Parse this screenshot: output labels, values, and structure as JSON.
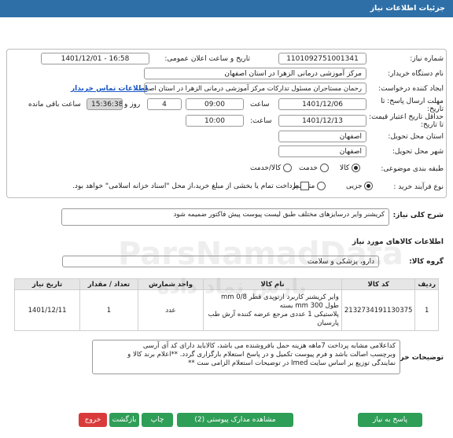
{
  "window": {
    "title": "جزئیات اطلاعات نیاز"
  },
  "fields": {
    "need_number_label": "شماره نیاز:",
    "need_number": "1101092751001341",
    "announce_datetime_label": "تاریخ و ساعت اعلان عمومی:",
    "announce_datetime": "1401/12/01 - 16:58",
    "buyer_org_label": "نام دستگاه خریدار:",
    "buyer_org": "مرکز آموزشی درمانی الزهرا در استان اصفهان",
    "requester_label": "ایجاد کننده درخواست:",
    "requester": "رحمان مستاجران مسئول تدارکات مرکز آموزشی درمانی الزهرا در استان اصفهان",
    "buyer_contact_link": "اطلاعات تماس خریدار",
    "reply_deadline_label": "مهلت ارسال پاسخ: تا تاریخ:",
    "reply_deadline_date": "1401/12/06",
    "time_label": "ساعت",
    "reply_deadline_time": "09:00",
    "days_value": "4",
    "days_label": "روز و",
    "remaining_time": "15:36:38",
    "remaining_label": "ساعت باقی مانده",
    "price_validity_label": "حداقل تاریخ اعتبار قیمت: تا تاریخ:",
    "price_validity_date": "1401/12/13",
    "price_validity_time_label": "ساعت:",
    "price_validity_time": "10:00",
    "delivery_province_label": "استان محل تحویل:",
    "delivery_province": "اصفهان",
    "delivery_city_label": "شهر محل تحویل:",
    "delivery_city": "اصفهان",
    "category_label": "طبقه بندی موضوعی:",
    "category_options": [
      "کالا",
      "خدمت",
      "کالا/خدمت"
    ],
    "process_label": "نوع فرآیند خرید :",
    "process_options": [
      "جزیی",
      "متوسط"
    ],
    "payment_note": "پرداخت تمام یا بخشی از مبلغ خرید،از محل \"اسناد خزانه اسلامی\" خواهد بود."
  },
  "general_description": {
    "label": "شرح کلی نیاز:",
    "value": "کریشنر وایر درسایزهای مختلف طبق لیست پیوست پیش فاکتور ضمیمه شود"
  },
  "goods_section": {
    "title": "اطلاعات کالاهای مورد نیاز",
    "group_label": "گروه کالا:",
    "group_value": "دارو، پزشکی و سلامت"
  },
  "table": {
    "headers": [
      "ردیف",
      "کد کالا",
      "نام کالا",
      "واحد شمارش",
      "تعداد / مقدار",
      "تاریخ نیاز"
    ],
    "rows": [
      {
        "row": "1",
        "code": "2132734191130375",
        "name_line1": "وایر کریشنر کاربرد ارتوپدی قطر 0/8 mm طول 300 mm بسته",
        "name_line2": "پلاستیکی 1 عددی مرجع عرضه کننده آرش طب پارسیان",
        "unit": "عدد",
        "qty": "1",
        "date": "1401/12/11"
      }
    ]
  },
  "buyer_notes": {
    "label": "توضیحات خریدار:",
    "line1": "کداعلامی مشابه پرداخت 7ماهه  هزینه حمل بافروشنده می باشد، کالاباید دارای کد آی آرسی",
    "line2": "وبرچسب اصالت باشد و فرم پیوست تکمیل و در پاسخ استعلام بارگزاری گردد. **اعلام برند کالا و",
    "line3": "نمایندگی توزیع بر اساس سایت Imed در توضیحات استعلام الزامی ست **"
  },
  "buttons": {
    "reply": "پاسخ به نیاز",
    "attachments": "مشاهده مدارک پیوستی (2)",
    "print": "چاپ",
    "back": "بازگشت",
    "exit": "خروج"
  },
  "watermark": {
    "line1": "ParsNamadData",
    "line2": "پارس نماد داده"
  }
}
